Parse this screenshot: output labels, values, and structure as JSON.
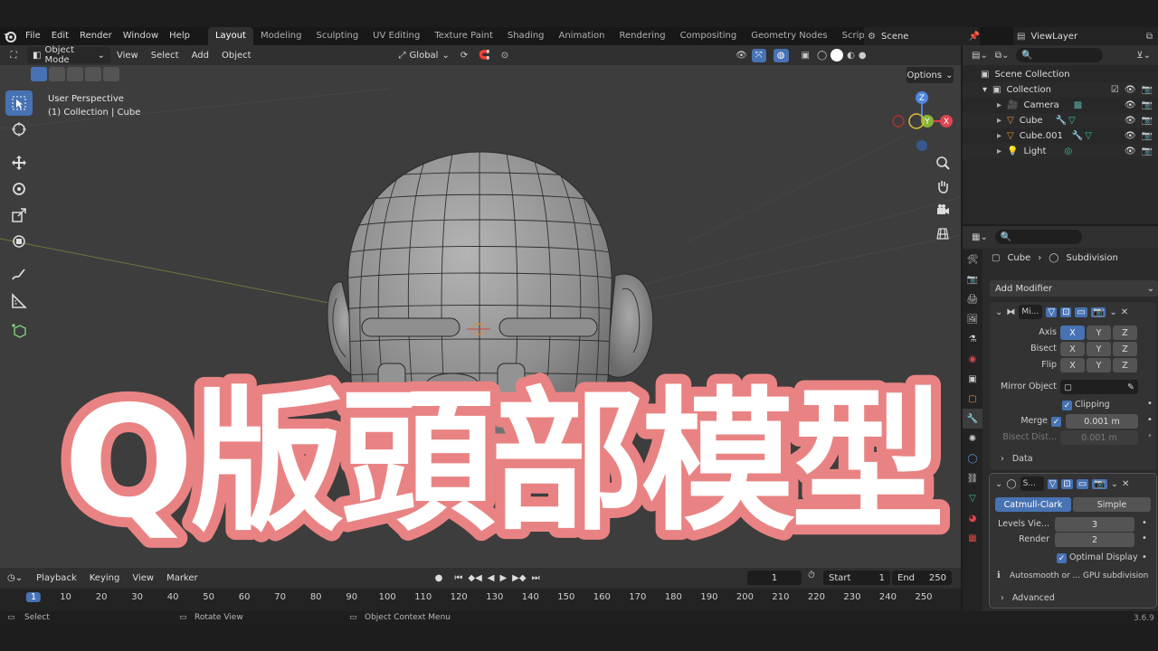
{
  "app": {
    "menus": [
      "File",
      "Edit",
      "Render",
      "Window",
      "Help"
    ],
    "workspaces": [
      "Layout",
      "Modeling",
      "Sculpting",
      "UV Editing",
      "Texture Paint",
      "Shading",
      "Animation",
      "Rendering",
      "Compositing",
      "Geometry Nodes",
      "Scripting"
    ],
    "active_workspace": "Layout",
    "add_workspace": "+",
    "scene": "Scene",
    "view_layer": "ViewLayer",
    "version": "3.6.9"
  },
  "viewport": {
    "mode": "Object Mode",
    "menus": [
      "View",
      "Select",
      "Add",
      "Object"
    ],
    "orientation": "Global",
    "perspective_label": "User Perspective",
    "collection_label": "(1) Collection | Cube",
    "options_label": "Options",
    "gizmo_axes": {
      "z": "Z",
      "y": "Y",
      "x": "X"
    }
  },
  "title_overlay": {
    "text": "Q版頭部模型"
  },
  "timeline": {
    "menus": [
      "Playback",
      "Keying",
      "View",
      "Marker"
    ],
    "current_frame": "1",
    "start_label": "Start",
    "start": "1",
    "end_label": "End",
    "end": "250",
    "ruler_ticks": [
      "1",
      "10",
      "20",
      "30",
      "40",
      "50",
      "60",
      "70",
      "80",
      "90",
      "100",
      "110",
      "120",
      "130",
      "140",
      "150",
      "160",
      "170",
      "180",
      "190",
      "200",
      "210",
      "220",
      "230",
      "240",
      "250"
    ]
  },
  "statusbar": {
    "select": "Select",
    "rotate": "Rotate View",
    "context_menu": "Object Context Menu"
  },
  "outliner": {
    "scene_collection": "Scene Collection",
    "collection": "Collection",
    "items": [
      {
        "name": "Camera",
        "color": "#5aa7a0"
      },
      {
        "name": "Cube",
        "color": "#e8923b"
      },
      {
        "name": "Cube.001",
        "color": "#e8923b"
      },
      {
        "name": "Light",
        "color": "#e8923b"
      }
    ]
  },
  "properties": {
    "object": "Cube",
    "modifier_context": "Subdivision",
    "add_modifier": "Add Modifier",
    "mirror": {
      "name": "Mi...",
      "axis_label": "Axis",
      "bisect_label": "Bisect",
      "flip_label": "Flip",
      "x": "X",
      "y": "Y",
      "z": "Z",
      "mirror_object_label": "Mirror Object",
      "clipping_label": "Clipping",
      "merge_label": "Merge",
      "merge_value": "0.001 m",
      "bisect_dist_label": "Bisect Dist...",
      "bisect_dist_value": "0.001 m",
      "data_label": "Data"
    },
    "subdivision": {
      "name": "S...",
      "catmull": "Catmull-Clark",
      "simple": "Simple",
      "levels_label": "Levels Vie...",
      "levels_value": "3",
      "render_label": "Render",
      "render_value": "2",
      "optimal_label": "Optimal Display",
      "note": "Autosmooth or ... GPU subdivision",
      "advanced_label": "Advanced"
    }
  }
}
